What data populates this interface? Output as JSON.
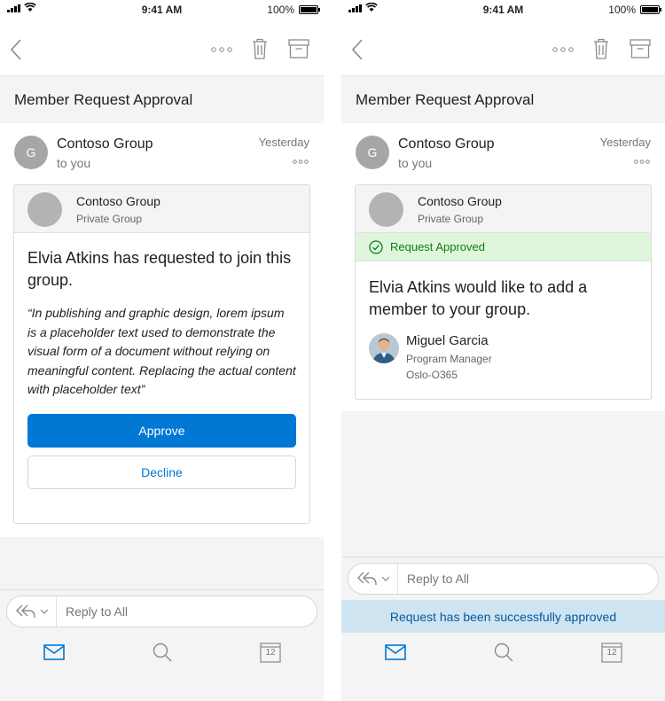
{
  "status_bar": {
    "time": "9:41 AM",
    "battery": "100%"
  },
  "subject": "Member Request Approval",
  "sender": {
    "initial": "G",
    "name": "Contoso Group",
    "recipient": "to you",
    "timestamp": "Yesterday"
  },
  "group": {
    "name": "Contoso Group",
    "type": "Private Group"
  },
  "request_screen": {
    "headline": "Elvia Atkins has requested to join this group.",
    "quote": "“In publishing and graphic design, lorem ipsum is a placeholder text used to demonstrate the visual form of a document without relying on meaningful content. Replacing the actual content with placeholder text”",
    "approve_label": "Approve",
    "decline_label": "Decline"
  },
  "approved_screen": {
    "status": "Request Approved",
    "headline": "Elvia Atkins would like to add a member to your group.",
    "member": {
      "name": "Miguel Garcia",
      "title": "Program Manager",
      "location": "Oslo-O365"
    },
    "toast": "Request has been successfully approved"
  },
  "reply": {
    "placeholder": "Reply to All"
  },
  "tabs": {
    "calendar_day": "12"
  },
  "colors": {
    "accent": "#0078d4",
    "success_bg": "#dff6dd",
    "success_text": "#107c10",
    "toast_bg": "#cfe4f1"
  }
}
